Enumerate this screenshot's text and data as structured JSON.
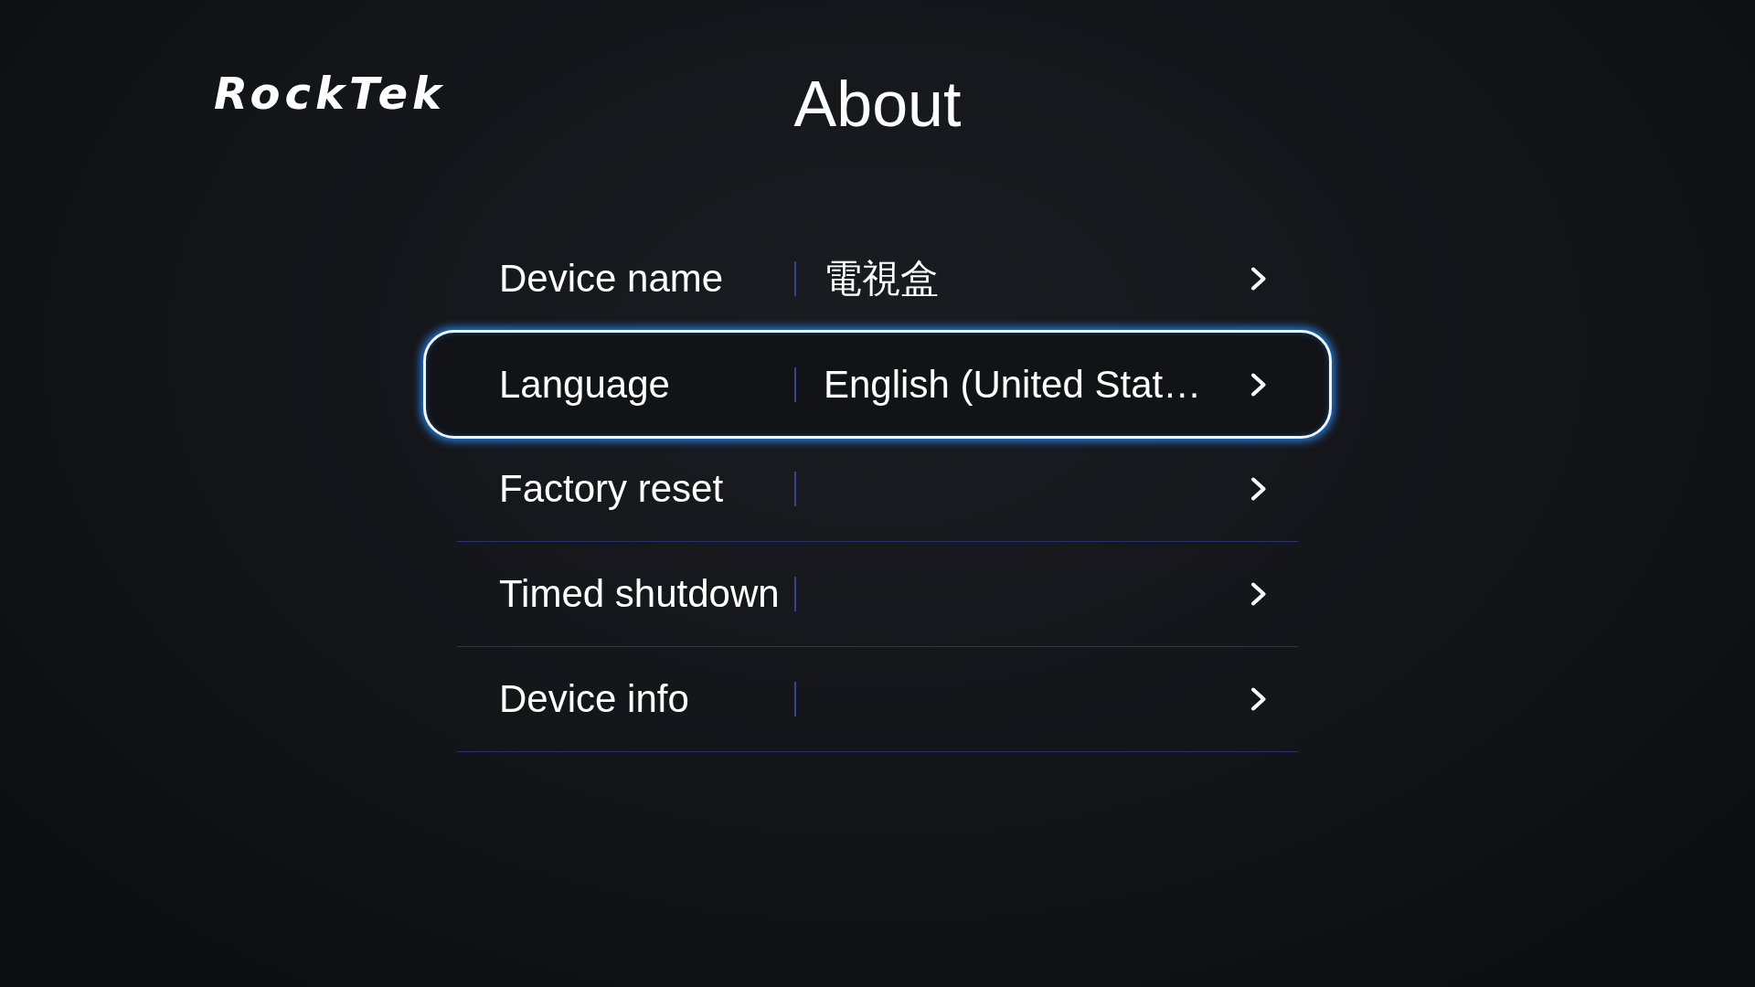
{
  "logo": {
    "text": "RockTek"
  },
  "title": "About",
  "settings": [
    {
      "label": "Device name",
      "value": "電視盒",
      "selected": false
    },
    {
      "label": "Language",
      "value": "English (United Stat…",
      "selected": true
    },
    {
      "label": "Factory reset",
      "selected": false
    },
    {
      "label": "Timed shutdown",
      "selected": false
    },
    {
      "label": "Device info",
      "selected": false
    }
  ]
}
